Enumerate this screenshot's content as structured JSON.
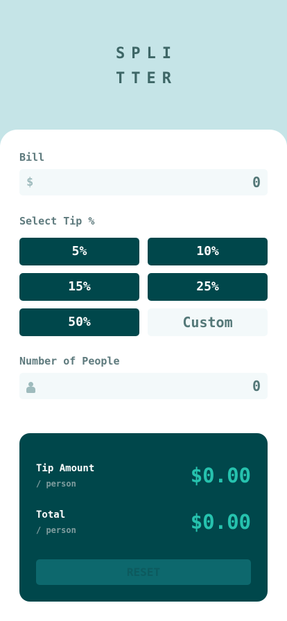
{
  "app": {
    "logo_line1": "SPLI",
    "logo_line2": "TTER"
  },
  "bill": {
    "label": "Bill",
    "currency_symbol": "$",
    "value": "0"
  },
  "tip": {
    "label": "Select Tip %",
    "options": [
      "5%",
      "10%",
      "15%",
      "25%",
      "50%"
    ],
    "custom_placeholder": "Custom"
  },
  "people": {
    "label": "Number of People",
    "icon": "person-icon",
    "value": "0"
  },
  "results": {
    "tip_amount_label": "Tip Amount",
    "tip_amount_sub": "/ person",
    "tip_amount_value": "$0.00",
    "total_label": "Total",
    "total_sub": "/ person",
    "total_value": "$0.00",
    "reset_label": "RESET"
  },
  "colors": {
    "background": "#c5e4e7",
    "card": "#ffffff",
    "dark_cyan": "#00474b",
    "accent": "#26c2ae",
    "input_bg": "#f3f9fa"
  }
}
